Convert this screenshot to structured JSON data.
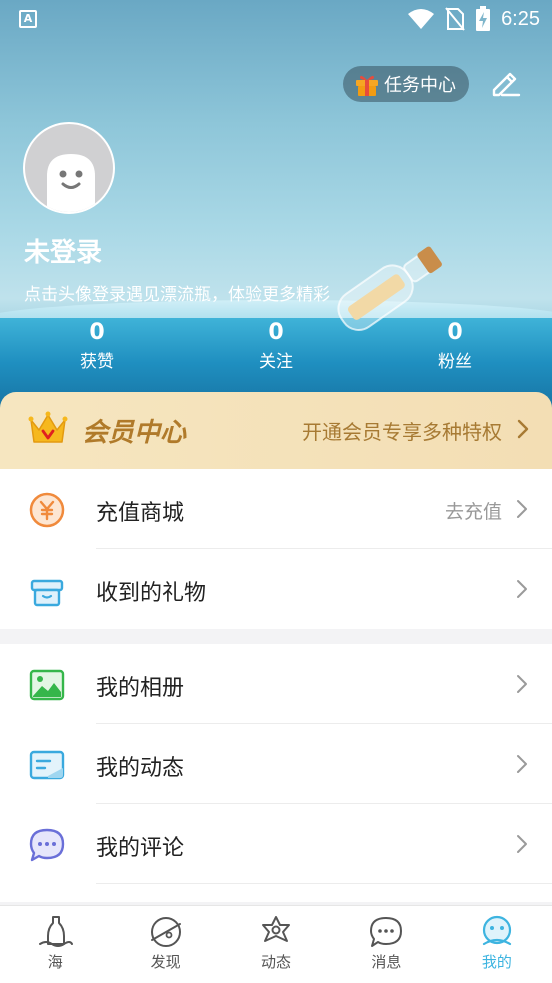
{
  "status_bar": {
    "time": "6:25",
    "notification_icon": "A",
    "icons": [
      "wifi-icon",
      "no-sim-icon",
      "battery-charging-icon"
    ]
  },
  "header": {
    "task_center_label": "任务中心",
    "username": "未登录",
    "login_tip": "点击头像登录遇见漂流瓶，体验更多精彩",
    "stats": [
      {
        "value": "0",
        "label": "获赞"
      },
      {
        "value": "0",
        "label": "关注"
      },
      {
        "value": "0",
        "label": "粉丝"
      }
    ]
  },
  "vip": {
    "title": "会员中心",
    "promo": "开通会员专享多种特权"
  },
  "menu_group_1": [
    {
      "label": "充值商城",
      "extra": "去充值",
      "icon": "yuan-coin-icon"
    },
    {
      "label": "收到的礼物",
      "extra": "",
      "icon": "gift-box-icon"
    }
  ],
  "menu_group_2": [
    {
      "label": "我的相册",
      "icon": "photo-album-icon"
    },
    {
      "label": "我的动态",
      "icon": "moments-card-icon"
    },
    {
      "label": "我的评论",
      "icon": "comment-bubble-icon"
    }
  ],
  "tabbar": [
    {
      "label": "海",
      "icon": "sea-bottle-icon",
      "active": false
    },
    {
      "label": "发现",
      "icon": "planet-icon",
      "active": false
    },
    {
      "label": "动态",
      "icon": "flower-icon",
      "active": false
    },
    {
      "label": "消息",
      "icon": "message-bubble-icon",
      "active": false
    },
    {
      "label": "我的",
      "icon": "profile-face-icon",
      "active": true
    }
  ],
  "colors": {
    "accent": "#3db4e0",
    "vip_gold": "#b07a2a",
    "header_top": "#6aa8c4",
    "sea": "#1f8fc0"
  }
}
